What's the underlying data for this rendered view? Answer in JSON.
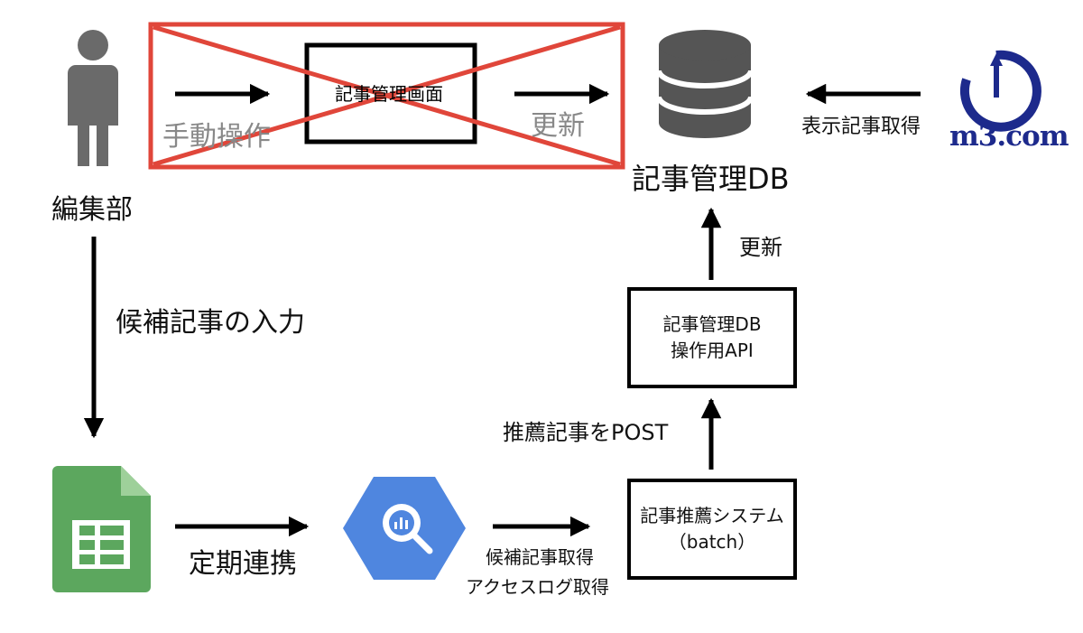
{
  "legacy_section": {
    "manual_operation_label": "手動操作",
    "admin_screen_label": "記事管理画面",
    "update_label": "更新"
  },
  "editor": {
    "label": "編集部"
  },
  "database": {
    "label": "記事管理DB"
  },
  "m3": {
    "logo_text": "m3.com",
    "fetch_label": "表示記事取得"
  },
  "edges": {
    "candidate_input": "候補記事の入力",
    "periodic_sync": "定期連携",
    "fetch_candidates": "候補記事取得",
    "fetch_access_logs": "アクセスログ取得",
    "post_recommended": "推薦記事をPOST",
    "update": "更新"
  },
  "api_box": {
    "line1": "記事管理DB",
    "line2": "操作用API"
  },
  "recommender_box": {
    "line1": "記事推薦システム",
    "line2": "（batch）"
  },
  "colors": {
    "cross_red": "#e0463a",
    "db_gray": "#555555",
    "sheets_green": "#5ca75e",
    "bigquery_blue": "#4f86df",
    "m3_navy": "#1d2a8c",
    "person_gray": "#6a6a6a"
  },
  "icons": [
    "person-icon",
    "database-icon",
    "m3-logo-icon",
    "sheets-icon",
    "bigquery-icon"
  ]
}
